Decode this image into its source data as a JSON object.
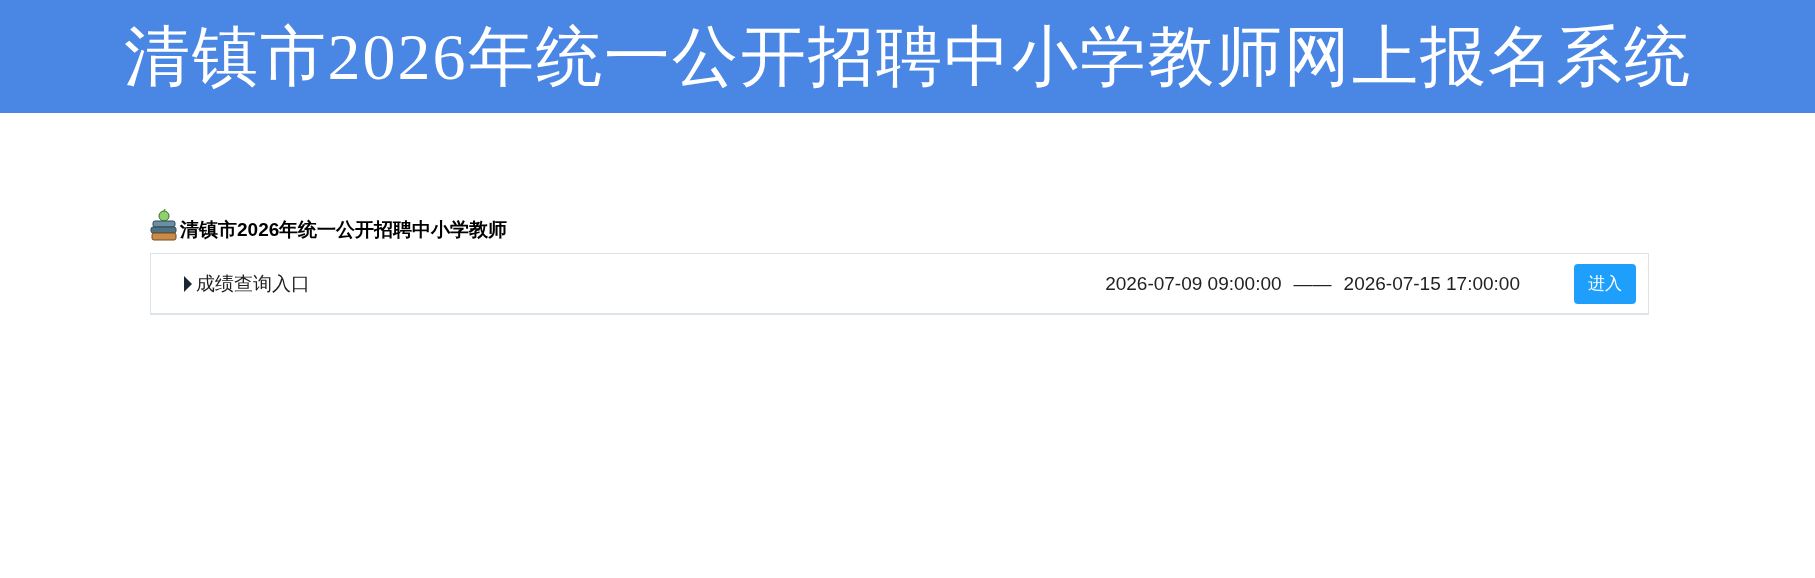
{
  "header": {
    "title": "清镇市2026年统一公开招聘中小学教师网上报名系统"
  },
  "section": {
    "title": "清镇市2026年统一公开招聘中小学教师"
  },
  "entries": [
    {
      "label": "成绩查询入口",
      "start": "2026-07-09 09:00:00",
      "separator": "——",
      "end": "2026-07-15 17:00:00",
      "button": "进入"
    }
  ]
}
